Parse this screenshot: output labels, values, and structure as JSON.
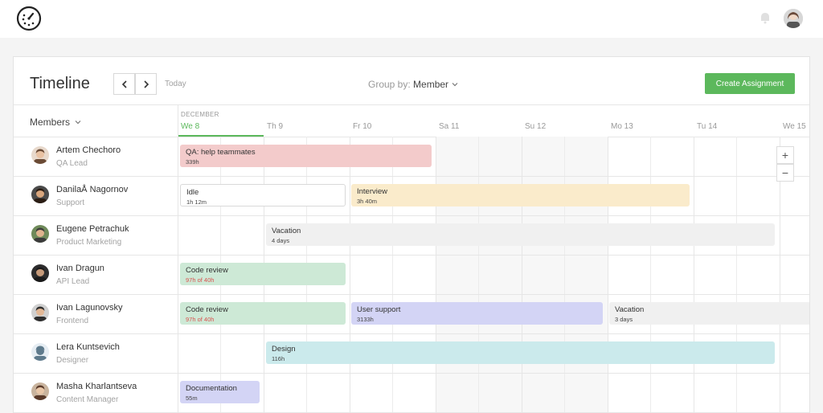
{
  "app": {
    "logo_icon": "clock-icon",
    "notification_icon": "bell-icon"
  },
  "header": {
    "title": "Timeline",
    "today": "Today",
    "group_by_label": "Group by:",
    "group_by_value": "Member",
    "create_button": "Create Assignment",
    "members_dropdown": "Members"
  },
  "calendar": {
    "month": "DECEMBER",
    "days": [
      {
        "label": "We 8",
        "active": true
      },
      {
        "label": "Th 9",
        "active": false
      },
      {
        "label": "Fr 10",
        "active": false
      },
      {
        "label": "Sa 11",
        "active": false
      },
      {
        "label": "Su 12",
        "active": false
      },
      {
        "label": "Mo 13",
        "active": false
      },
      {
        "label": "Tu 14",
        "active": false
      },
      {
        "label": "We 15",
        "active": false
      }
    ]
  },
  "zoom": {
    "in": "+",
    "out": "−"
  },
  "members": [
    {
      "name": "Artem Chechoro",
      "role": "QA Lead",
      "assignments": [
        {
          "title": "QA: help teammates",
          "sub": "339h",
          "color": "red"
        }
      ]
    },
    {
      "name": "DanilaÅ Nagornov",
      "role": "Support",
      "assignments": [
        {
          "title": "Idle",
          "sub": "1h 12m",
          "color": "white"
        },
        {
          "title": "Interview",
          "sub": "3h 40m",
          "color": "yellow"
        }
      ]
    },
    {
      "name": "Eugene Petrachuk",
      "role": "Product Marketing",
      "assignments": [
        {
          "title": "Vacation",
          "sub": "4 days",
          "color": "gray"
        }
      ]
    },
    {
      "name": "Ivan Dragun",
      "role": "API Lead",
      "assignments": [
        {
          "title": "Code review",
          "sub": "97h of 40h",
          "color": "green",
          "over": true
        }
      ]
    },
    {
      "name": "Ivan Lagunovsky",
      "role": "Frontend",
      "assignments": [
        {
          "title": "Code review",
          "sub": "97h of 40h",
          "color": "green",
          "over": true
        },
        {
          "title": "User support",
          "sub": "3133h",
          "color": "purple"
        },
        {
          "title": "Vacation",
          "sub": "3 days",
          "color": "gray"
        }
      ]
    },
    {
      "name": "Lera Kuntsevich",
      "role": "Designer",
      "assignments": [
        {
          "title": "Design",
          "sub": "116h",
          "color": "teal"
        }
      ]
    },
    {
      "name": "Masha Kharlantseva",
      "role": "Content Manager",
      "assignments": [
        {
          "title": "Documentation",
          "sub": "55m",
          "color": "purple"
        }
      ]
    }
  ]
}
